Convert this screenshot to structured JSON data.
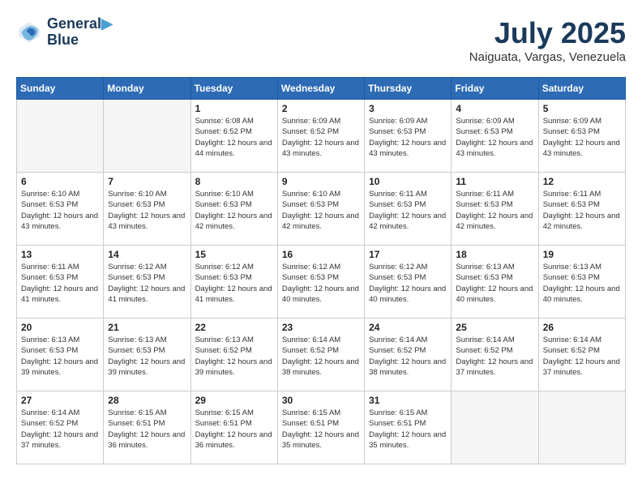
{
  "header": {
    "logo_line1": "General",
    "logo_line2": "Blue",
    "month_title": "July 2025",
    "location": "Naiguata, Vargas, Venezuela"
  },
  "days_of_week": [
    "Sunday",
    "Monday",
    "Tuesday",
    "Wednesday",
    "Thursday",
    "Friday",
    "Saturday"
  ],
  "weeks": [
    [
      {
        "day": "",
        "info": ""
      },
      {
        "day": "",
        "info": ""
      },
      {
        "day": "1",
        "info": "Sunrise: 6:08 AM\nSunset: 6:52 PM\nDaylight: 12 hours and 44 minutes."
      },
      {
        "day": "2",
        "info": "Sunrise: 6:09 AM\nSunset: 6:52 PM\nDaylight: 12 hours and 43 minutes."
      },
      {
        "day": "3",
        "info": "Sunrise: 6:09 AM\nSunset: 6:53 PM\nDaylight: 12 hours and 43 minutes."
      },
      {
        "day": "4",
        "info": "Sunrise: 6:09 AM\nSunset: 6:53 PM\nDaylight: 12 hours and 43 minutes."
      },
      {
        "day": "5",
        "info": "Sunrise: 6:09 AM\nSunset: 6:53 PM\nDaylight: 12 hours and 43 minutes."
      }
    ],
    [
      {
        "day": "6",
        "info": "Sunrise: 6:10 AM\nSunset: 6:53 PM\nDaylight: 12 hours and 43 minutes."
      },
      {
        "day": "7",
        "info": "Sunrise: 6:10 AM\nSunset: 6:53 PM\nDaylight: 12 hours and 43 minutes."
      },
      {
        "day": "8",
        "info": "Sunrise: 6:10 AM\nSunset: 6:53 PM\nDaylight: 12 hours and 42 minutes."
      },
      {
        "day": "9",
        "info": "Sunrise: 6:10 AM\nSunset: 6:53 PM\nDaylight: 12 hours and 42 minutes."
      },
      {
        "day": "10",
        "info": "Sunrise: 6:11 AM\nSunset: 6:53 PM\nDaylight: 12 hours and 42 minutes."
      },
      {
        "day": "11",
        "info": "Sunrise: 6:11 AM\nSunset: 6:53 PM\nDaylight: 12 hours and 42 minutes."
      },
      {
        "day": "12",
        "info": "Sunrise: 6:11 AM\nSunset: 6:53 PM\nDaylight: 12 hours and 42 minutes."
      }
    ],
    [
      {
        "day": "13",
        "info": "Sunrise: 6:11 AM\nSunset: 6:53 PM\nDaylight: 12 hours and 41 minutes."
      },
      {
        "day": "14",
        "info": "Sunrise: 6:12 AM\nSunset: 6:53 PM\nDaylight: 12 hours and 41 minutes."
      },
      {
        "day": "15",
        "info": "Sunrise: 6:12 AM\nSunset: 6:53 PM\nDaylight: 12 hours and 41 minutes."
      },
      {
        "day": "16",
        "info": "Sunrise: 6:12 AM\nSunset: 6:53 PM\nDaylight: 12 hours and 40 minutes."
      },
      {
        "day": "17",
        "info": "Sunrise: 6:12 AM\nSunset: 6:53 PM\nDaylight: 12 hours and 40 minutes."
      },
      {
        "day": "18",
        "info": "Sunrise: 6:13 AM\nSunset: 6:53 PM\nDaylight: 12 hours and 40 minutes."
      },
      {
        "day": "19",
        "info": "Sunrise: 6:13 AM\nSunset: 6:53 PM\nDaylight: 12 hours and 40 minutes."
      }
    ],
    [
      {
        "day": "20",
        "info": "Sunrise: 6:13 AM\nSunset: 6:53 PM\nDaylight: 12 hours and 39 minutes."
      },
      {
        "day": "21",
        "info": "Sunrise: 6:13 AM\nSunset: 6:53 PM\nDaylight: 12 hours and 39 minutes."
      },
      {
        "day": "22",
        "info": "Sunrise: 6:13 AM\nSunset: 6:52 PM\nDaylight: 12 hours and 39 minutes."
      },
      {
        "day": "23",
        "info": "Sunrise: 6:14 AM\nSunset: 6:52 PM\nDaylight: 12 hours and 38 minutes."
      },
      {
        "day": "24",
        "info": "Sunrise: 6:14 AM\nSunset: 6:52 PM\nDaylight: 12 hours and 38 minutes."
      },
      {
        "day": "25",
        "info": "Sunrise: 6:14 AM\nSunset: 6:52 PM\nDaylight: 12 hours and 37 minutes."
      },
      {
        "day": "26",
        "info": "Sunrise: 6:14 AM\nSunset: 6:52 PM\nDaylight: 12 hours and 37 minutes."
      }
    ],
    [
      {
        "day": "27",
        "info": "Sunrise: 6:14 AM\nSunset: 6:52 PM\nDaylight: 12 hours and 37 minutes."
      },
      {
        "day": "28",
        "info": "Sunrise: 6:15 AM\nSunset: 6:51 PM\nDaylight: 12 hours and 36 minutes."
      },
      {
        "day": "29",
        "info": "Sunrise: 6:15 AM\nSunset: 6:51 PM\nDaylight: 12 hours and 36 minutes."
      },
      {
        "day": "30",
        "info": "Sunrise: 6:15 AM\nSunset: 6:51 PM\nDaylight: 12 hours and 35 minutes."
      },
      {
        "day": "31",
        "info": "Sunrise: 6:15 AM\nSunset: 6:51 PM\nDaylight: 12 hours and 35 minutes."
      },
      {
        "day": "",
        "info": ""
      },
      {
        "day": "",
        "info": ""
      }
    ]
  ]
}
